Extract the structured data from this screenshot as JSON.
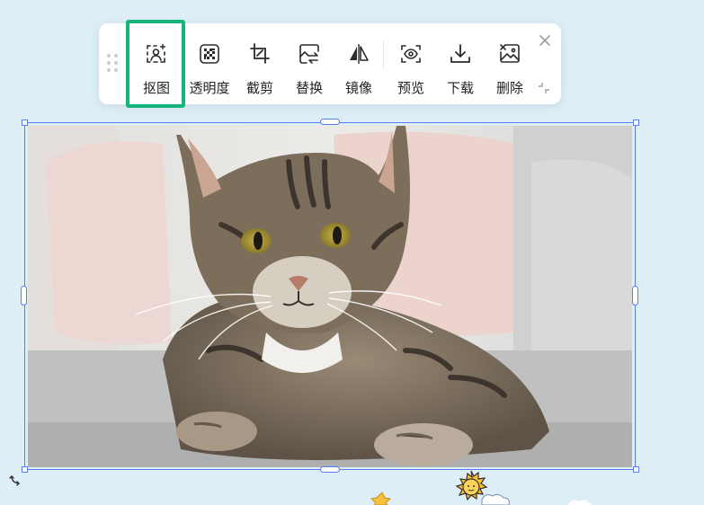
{
  "toolbar": {
    "tools": [
      {
        "name": "cutout",
        "label": "抠图",
        "icon": "cutout-person-icon"
      },
      {
        "name": "transparency",
        "label": "透明度",
        "icon": "checkerboard-icon"
      },
      {
        "name": "crop",
        "label": "截剪",
        "icon": "crop-icon"
      },
      {
        "name": "replace",
        "label": "替换",
        "icon": "replace-image-icon"
      },
      {
        "name": "mirror",
        "label": "镜像",
        "icon": "mirror-icon"
      },
      {
        "name": "preview",
        "label": "预览",
        "icon": "eye-icon"
      },
      {
        "name": "download",
        "label": "下载",
        "icon": "download-icon"
      },
      {
        "name": "delete",
        "label": "删除",
        "icon": "delete-image-icon"
      }
    ],
    "close_icon": "close-icon",
    "collapse_icon": "collapse-icon",
    "highlighted_tool": "cutout"
  },
  "colors": {
    "background": "#deeef7",
    "highlight": "#14b47a",
    "selection": "#5b7cf5",
    "icon": "#2b2b2b"
  },
  "canvas": {
    "selected_image": "tabby-cat-photo",
    "decorations": [
      "sun-sticker",
      "star-sticker",
      "cloud-sticker"
    ]
  }
}
